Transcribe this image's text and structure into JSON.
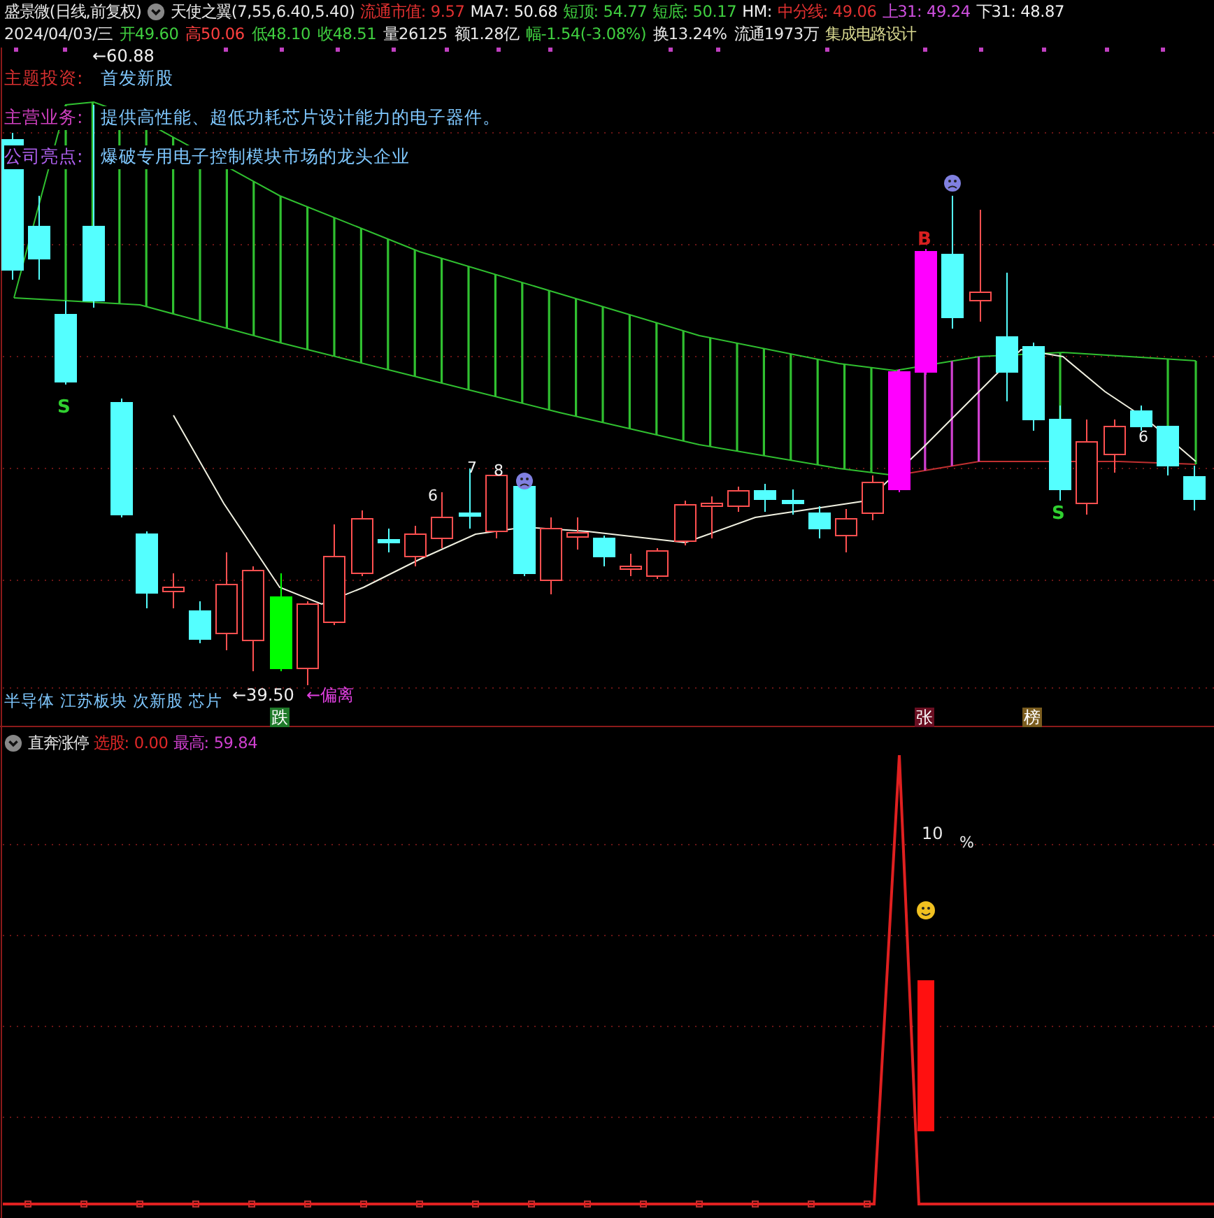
{
  "title_line": {
    "stock": "盛景微(日线,前复权)",
    "indicator": "天使之翼(7,55,6.40,5.40)",
    "fields": [
      {
        "label": "流通市值:",
        "value": "9.57",
        "color": "#e03030"
      },
      {
        "label": "MA7:",
        "value": "50.68",
        "color": "#f0f0f0"
      },
      {
        "label": "短顶:",
        "value": "54.77",
        "color": "#40d040"
      },
      {
        "label": "短底:",
        "value": "50.17",
        "color": "#40d040"
      },
      {
        "label": "HM:",
        "color": "#f0f0f0"
      },
      {
        "label": "中分线:",
        "value": "49.06",
        "color": "#e03030"
      },
      {
        "label": "上31:",
        "value": "49.24",
        "color": "#d050e0"
      },
      {
        "label": "下31:",
        "value": "48.87",
        "color": "#f0f0f0"
      }
    ]
  },
  "quote_line": {
    "date": "2024/04/03/三",
    "fields": [
      {
        "label": "开",
        "value": "49.60",
        "color": "#40d040"
      },
      {
        "label": "高",
        "value": "50.06",
        "color": "#ff4040"
      },
      {
        "label": "低",
        "value": "48.10",
        "color": "#40d040"
      },
      {
        "label": "收",
        "value": "48.51",
        "color": "#40d040"
      },
      {
        "label": "量",
        "value": "26125",
        "color": "#e8e8e8"
      },
      {
        "label": "额",
        "value": "1.28亿",
        "color": "#e8e8e8"
      },
      {
        "label": "幅",
        "value": "-1.54(-3.08%)",
        "color": "#40d040"
      },
      {
        "label": "换",
        "value": "13.24%",
        "color": "#e8e8e8"
      },
      {
        "label": "流通",
        "value": "1973万",
        "color": "#e8e8e8"
      },
      {
        "value": "集成电路设计",
        "color": "#d8d890"
      }
    ]
  },
  "notes": [
    {
      "label": "主题投资:",
      "text": "首发新股",
      "color": "#d83030"
    },
    {
      "label": "主营业务:",
      "text": "提供高性能、超低功耗芯片设计能力的电子器件。",
      "color": "#d040c0"
    },
    {
      "label": "公司亮点:",
      "text": "爆破专用电子控制模块市场的龙头企业",
      "color": "#b060f0"
    }
  ],
  "high_marker": "←60.88",
  "low_marker": "←39.50",
  "deviation_marker": "←偏离",
  "candle_labels": [
    {
      "text": "S",
      "kind": "sell"
    },
    {
      "text": "6",
      "kind": "count"
    },
    {
      "text": "7",
      "kind": "count"
    },
    {
      "text": "8",
      "kind": "count"
    },
    {
      "text": "B",
      "kind": "buy"
    },
    {
      "text": "S",
      "kind": "sell"
    },
    {
      "text": "6",
      "kind": "count"
    }
  ],
  "sector_tags": [
    "半导体",
    "江苏板块",
    "次新股",
    "芯片"
  ],
  "day_badges": [
    {
      "text": "跌",
      "color": "#1f7a2a"
    },
    {
      "text": "张",
      "color": "#6a0f22"
    },
    {
      "text": "榜",
      "color": "#7a5c1e"
    }
  ],
  "indicator_panel": {
    "name": "直奔涨停",
    "fields": [
      {
        "label": "选股:",
        "value": "0.00",
        "color": "#e02828"
      },
      {
        "label": "最高:",
        "value": "59.84",
        "color": "#d040d0"
      }
    ],
    "value_label": "10",
    "unit_label": "%"
  }
}
